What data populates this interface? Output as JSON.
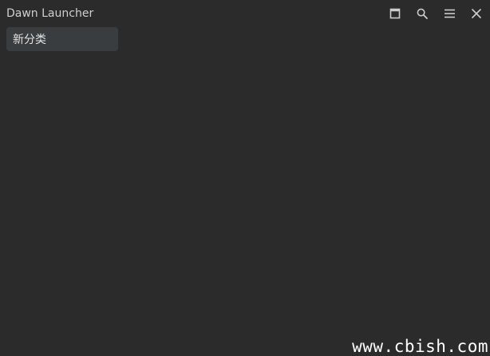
{
  "app": {
    "title": "Dawn Launcher"
  },
  "window_controls": [
    {
      "name": "maximize",
      "icon": "maximize-icon"
    },
    {
      "name": "search",
      "icon": "search-icon"
    },
    {
      "name": "menu",
      "icon": "hamburger-menu-icon"
    },
    {
      "name": "close",
      "icon": "close-icon"
    }
  ],
  "categories": [
    {
      "label": "新分类",
      "selected": true
    }
  ],
  "watermark": {
    "text": "www.cbish.com"
  },
  "colors": {
    "background": "#2b2b2b",
    "category_tab_bg": "#3a3d40",
    "title_text": "#cfcfcf",
    "icon": "#cccccc"
  }
}
